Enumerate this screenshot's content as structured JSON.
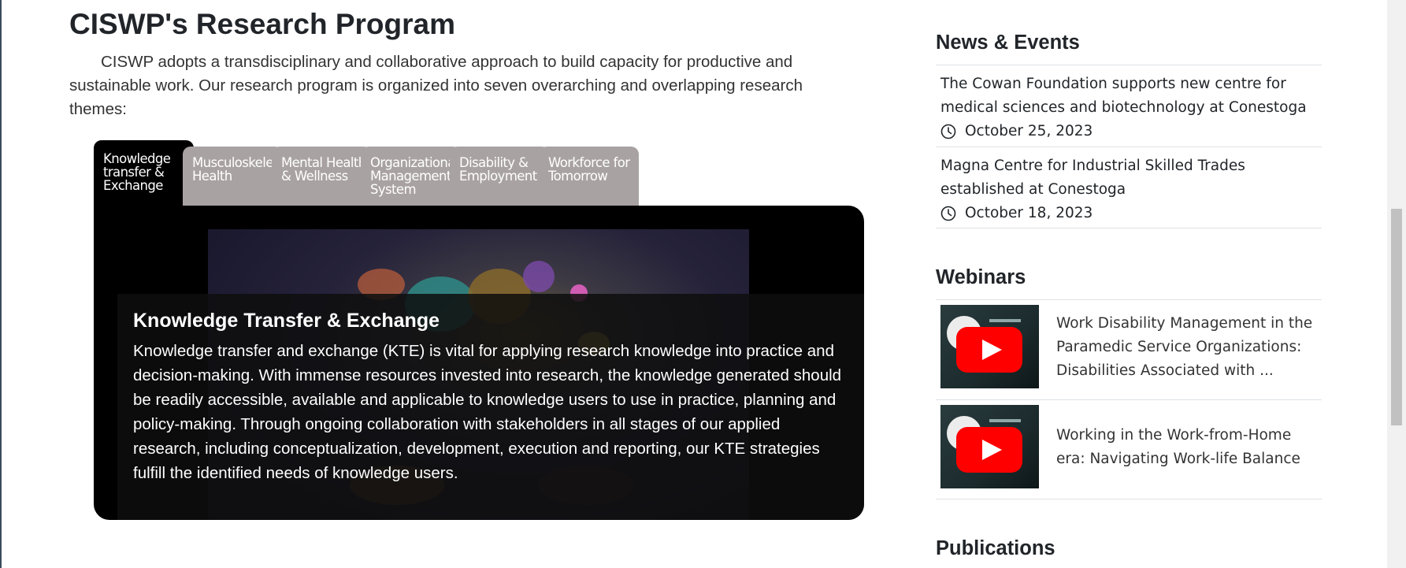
{
  "main": {
    "title": "CISWP's Research Program",
    "intro": "CISWP adopts a transdisciplinary and collaborative approach to build capacity for productive and sustainable work. Our research program is organized into seven overarching and overlapping research themes:",
    "tabs": [
      {
        "label": "Knowledge transfer & Exchange",
        "active": true
      },
      {
        "label": "Musculoskeleta Health",
        "active": false
      },
      {
        "label": "Mental Health & Wellness",
        "active": false
      },
      {
        "label": "Organizational Management System",
        "active": false
      },
      {
        "label": "Disability & Employment",
        "active": false
      },
      {
        "label": "Workforce for Tomorrow",
        "active": false
      }
    ],
    "panel": {
      "heading": "Knowledge Transfer & Exchange",
      "body": "Knowledge transfer and exchange (KTE) is vital for applying research knowledge into practice and decision-making. With immense resources invested into research, the knowledge generated should be readily accessible, available and applicable to knowledge users to use in practice, planning and policy-making. Through ongoing collaboration with stakeholders in all stages of our applied research, including conceptualization, development, execution and reporting, our KTE strategies fulfill the identified needs of knowledge users."
    }
  },
  "sidebar": {
    "news_heading": "News & Events",
    "news": [
      {
        "title": "The Cowan Foundation supports new centre for medical sciences and biotechnology at Conestoga",
        "date": "October 25, 2023",
        "icon": "clock-icon"
      },
      {
        "title": "Magna Centre for Industrial Skilled Trades established at Conestoga",
        "date": "October 18, 2023",
        "icon": "clock-icon"
      }
    ],
    "webinars_heading": "Webinars",
    "webinars": [
      {
        "title": "Work Disability Management in the Paramedic Service Organizations: Disabilities Associated with ...",
        "icon": "youtube-play-icon"
      },
      {
        "title": "Working in the Work-from-Home era: Navigating Work-life Balance",
        "icon": "youtube-play-icon"
      }
    ],
    "publications_heading": "Publications"
  },
  "colors": {
    "tab_inactive": "#a9a2a2",
    "tab_active": "#000000",
    "play_button": "#ff0000"
  }
}
